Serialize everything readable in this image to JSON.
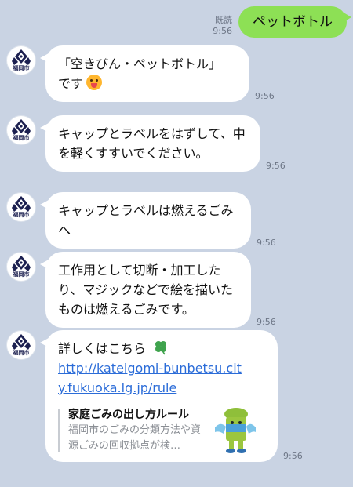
{
  "outgoing": {
    "text": "ペットボトル",
    "read": "既読",
    "time": "9:56"
  },
  "avatar_label": "福岡市",
  "messages": [
    {
      "line1": "「空きびん・ペットボトル」",
      "line2": "です",
      "time": "9:56"
    },
    {
      "text": "キャップとラベルをはずして、中を軽くすすいでください。",
      "time": "9:56"
    },
    {
      "text": "キャップとラベルは燃えるごみへ",
      "time": "9:56"
    },
    {
      "text": "工作用として切断・加工したり、マジックなどで絵を描いたものは燃えるごみです。",
      "time": "9:56"
    }
  ],
  "link_message": {
    "text": "詳しくはこちら",
    "url": "http://kateigomi-bunbetsu.city.fukuoka.lg.jp/rule",
    "preview_title": "家庭ごみの出し方ルール",
    "preview_desc": "福岡市のごみの分類方法や資源ごみの回収拠点が検…",
    "time": "9:56"
  },
  "colors": {
    "background": "#c9d3e3",
    "outgoing_bubble": "#8de055",
    "link": "#2b6cd8"
  },
  "icons": [
    "fukuoka-city-logo-icon",
    "grinning-emoji-icon",
    "four-leaf-clover-icon",
    "mascot-icon"
  ]
}
